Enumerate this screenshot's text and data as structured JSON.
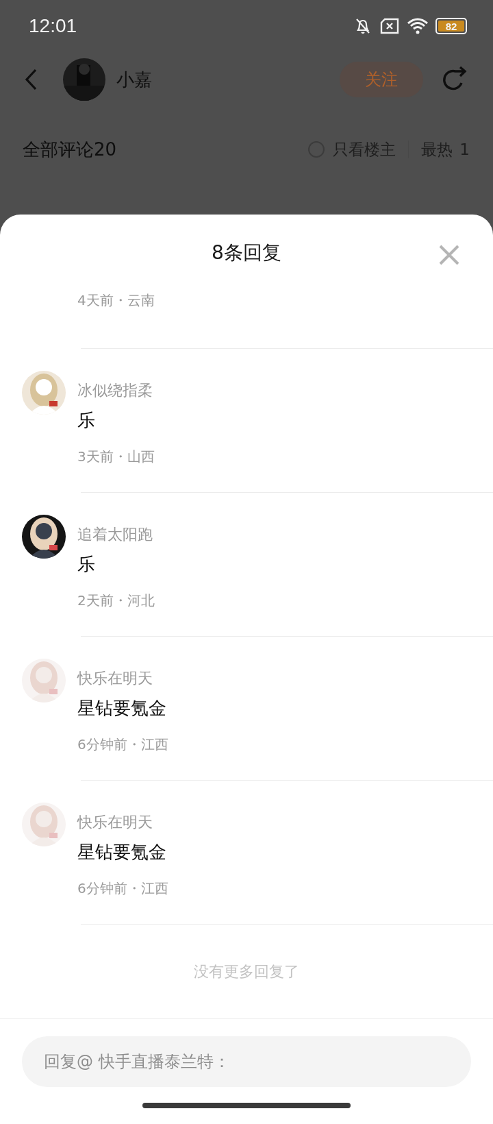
{
  "status_bar": {
    "time": "12:01",
    "battery": "82"
  },
  "header": {
    "author": "小嘉",
    "follow_button": "关注"
  },
  "comments_header": {
    "title": "全部评论20",
    "only_author": {
      "label": "只看楼主",
      "checked": false
    },
    "sort": "最热",
    "sort_extra": "1"
  },
  "sheet": {
    "title": "8条回复",
    "partial_meta": "4天前・云南",
    "replies": [
      {
        "name": "冰似绕指柔",
        "text": "乐",
        "meta": "3天前・山西"
      },
      {
        "name": "追着太阳跑",
        "text": "乐",
        "meta": "2天前・河北"
      },
      {
        "name": "快乐在明天",
        "text": "星钻要氪金",
        "meta": "6分钟前・江西"
      },
      {
        "name": "快乐在明天",
        "text": "星钻要氪金",
        "meta": "6分钟前・江西"
      }
    ],
    "end_note": "没有更多回复了",
    "reply_field": {
      "placeholder": "回复@ 快手直播泰兰特："
    }
  }
}
